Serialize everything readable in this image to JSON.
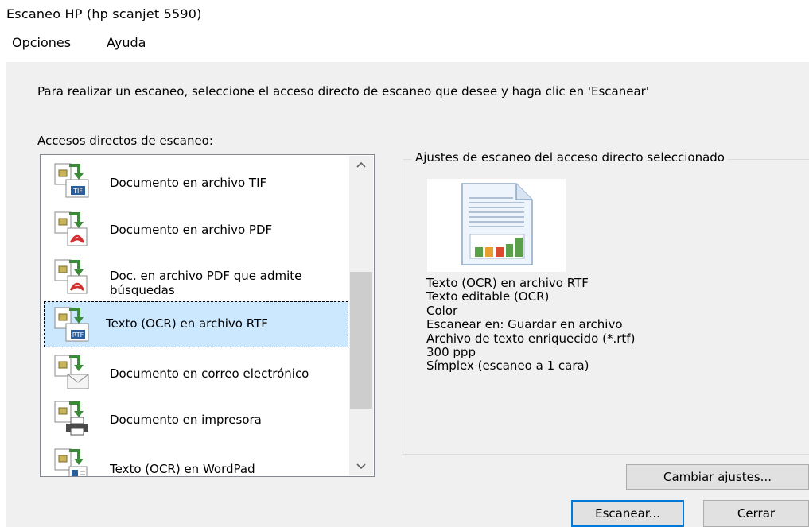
{
  "window": {
    "title": "Escaneo HP (hp scanjet 5590)"
  },
  "menu": [
    "Opciones",
    "Ayuda"
  ],
  "instructions": "Para realizar un escaneo, seleccione el acceso directo de escaneo que desee y haga clic en 'Escanear'",
  "shortcuts": {
    "label": "Accesos directos de escaneo:",
    "items": [
      {
        "label": "Documento en archivo TIF",
        "icon": "tif-file-icon"
      },
      {
        "label": "Documento en archivo PDF",
        "icon": "pdf-file-icon"
      },
      {
        "label_line1": "Doc. en archivo PDF que admite",
        "label_line2": "búsquedas",
        "icon": "searchable-pdf-icon"
      },
      {
        "label": "Texto (OCR) en archivo RTF",
        "icon": "rtf-file-icon",
        "selected": true
      },
      {
        "label": "Documento en correo electrónico",
        "icon": "email-icon"
      },
      {
        "label": "Documento en impresora",
        "icon": "printer-icon"
      },
      {
        "label": "Texto (OCR) en WordPad",
        "icon": "wordpad-icon"
      }
    ]
  },
  "settings": {
    "group_label": "Ajustes de escaneo del acceso directo seleccionado",
    "preview_icon": "rich-text-document-icon",
    "lines": [
      "Texto (OCR) en archivo RTF",
      "Texto editable (OCR)",
      "Color",
      "Escanear en: Guardar en archivo",
      "Archivo de texto enriquecido (*.rtf)",
      "300 ppp",
      "Símplex (escaneo a 1 cara)"
    ]
  },
  "buttons": {
    "change_settings": "Cambiar ajustes...",
    "scan": "Escanear...",
    "close": "Cerrar"
  },
  "colors": {
    "selection": "#cce8ff",
    "default_button_border": "#0078d7",
    "dialog_background": "#f0f0f0"
  }
}
